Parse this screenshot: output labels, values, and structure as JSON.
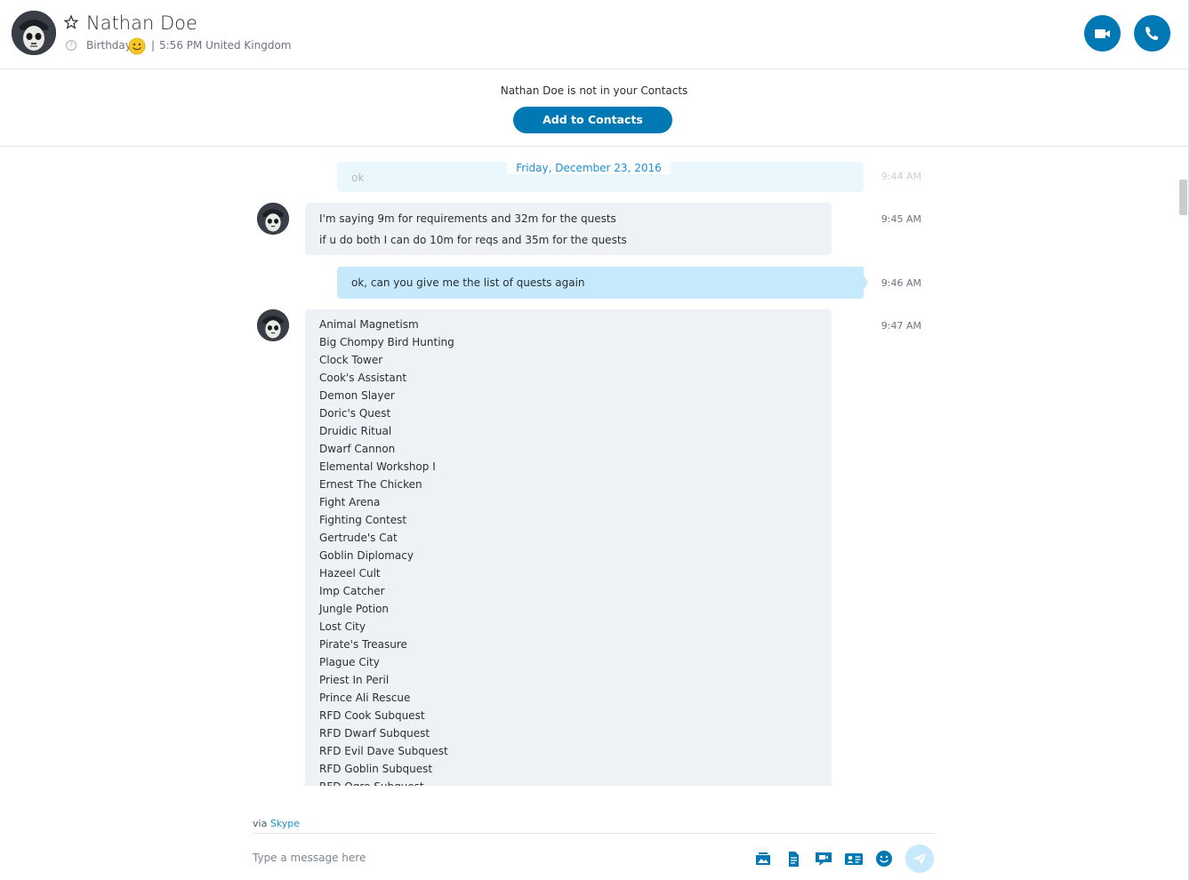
{
  "header": {
    "name": "Nathan Doe",
    "mood": "Birthday",
    "separator": "|",
    "local_time": "5:56 PM United Kingdom",
    "help_glyph": "?"
  },
  "banner": {
    "text": "Nathan Doe is not in your Contacts",
    "button_label": "Add to Contacts"
  },
  "conversation": {
    "date_divider": "Friday, December 23, 2016",
    "messages": [
      {
        "direction": "out",
        "lines": [
          "ok"
        ],
        "time": "9:44 AM"
      },
      {
        "direction": "in",
        "lines": [
          "I'm saying 9m for requirements and 32m for the quests",
          "if u do both I can do 10m for reqs and 35m for the quests"
        ],
        "time": "9:45 AM"
      },
      {
        "direction": "out",
        "lines": [
          "ok, can you give me the list of quests again"
        ],
        "time": "9:46 AM"
      },
      {
        "direction": "in",
        "time": "9:47 AM",
        "lines": [
          "Animal Magnetism",
          "Big Chompy Bird Hunting",
          "Clock Tower",
          "Cook's Assistant",
          "Demon Slayer",
          "Doric's Quest",
          "Druidic Ritual",
          "Dwarf Cannon",
          "Elemental Workshop I",
          "Ernest The Chicken",
          "Fight Arena",
          "Fighting Contest",
          "Gertrude's Cat",
          "Goblin Diplomacy",
          "Hazeel Cult",
          "Imp Catcher",
          "Jungle Potion",
          "Lost City",
          "Pirate's Treasure",
          "Plague City",
          "Priest In Peril",
          "Prince Ali Rescue",
          "RFD Cook Subquest",
          "RFD Dwarf Subquest",
          "RFD Evil Dave Subquest",
          "RFD Goblin Subquest",
          "RFD Ogre Subquest"
        ]
      }
    ]
  },
  "composer": {
    "via_prefix": "via",
    "via_link": "Skype",
    "placeholder": "Type a message here",
    "tools": [
      "media-gallery-icon",
      "file-icon",
      "video-message-icon",
      "contact-card-icon",
      "emoticon-icon"
    ]
  },
  "colors": {
    "accent": "#0078b4",
    "outgoing_bubble": "#c6e9fb",
    "incoming_bubble": "#eef1f6",
    "link": "#1f8fcf"
  }
}
